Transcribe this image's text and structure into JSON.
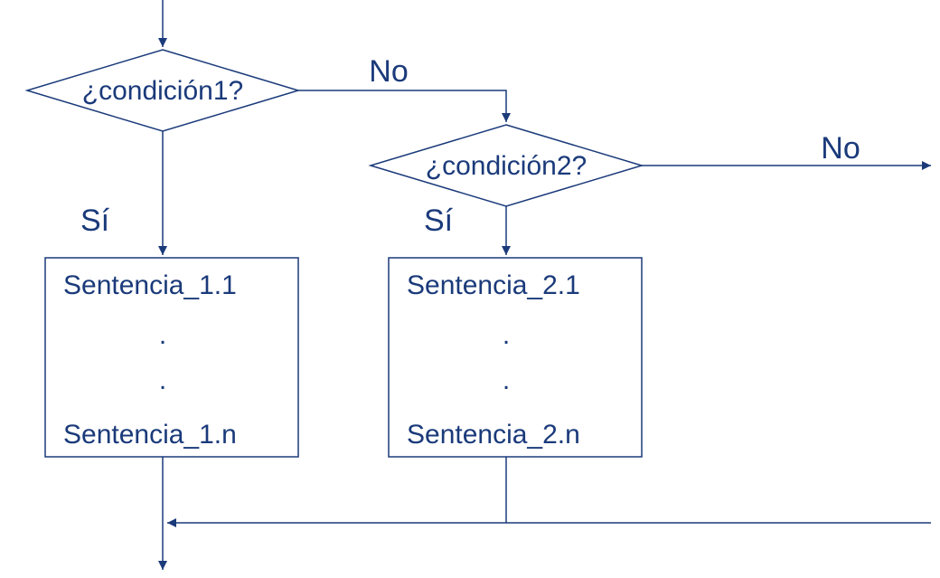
{
  "diagram": {
    "type": "flowchart",
    "decision1": {
      "text": "¿condición1?",
      "yes": "Sí",
      "no": "No"
    },
    "decision2": {
      "text": "¿condición2?",
      "yes": "Sí",
      "no": "No"
    },
    "block1": {
      "line1": "Sentencia_1.1",
      "dot1": ".",
      "dot2": ".",
      "line_n": "Sentencia_1.n"
    },
    "block2": {
      "line1": "Sentencia_2.1",
      "dot1": ".",
      "dot2": ".",
      "line_n": "Sentencia_2.n"
    }
  }
}
